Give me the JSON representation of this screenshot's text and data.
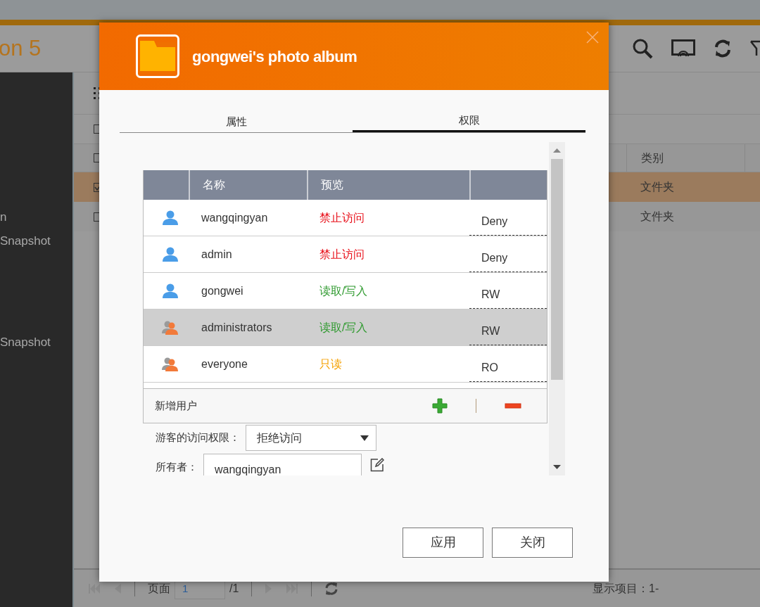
{
  "app": {
    "title": "on 5"
  },
  "sidebar": {
    "items": [
      {
        "label": "n"
      },
      {
        "label": "Snapshot"
      },
      {
        "label": "Snapshot"
      }
    ]
  },
  "files": {
    "toolbar_checkbox": {
      "checked": false
    },
    "header_checkbox": {
      "checked": false
    },
    "columns": [
      "类别"
    ],
    "rows": [
      {
        "type": "文件夹",
        "selected": true,
        "checked": true
      },
      {
        "type": "文件夹",
        "selected": false,
        "checked": false
      }
    ]
  },
  "pager": {
    "page_label": "页面",
    "page": "1",
    "total": "/1",
    "summary": "显示项目：1-"
  },
  "dialog": {
    "title": "gongwei's photo album",
    "tabs": [
      {
        "label": "属性",
        "selected": false
      },
      {
        "label": "权限",
        "selected": true
      }
    ],
    "columns": [
      "名称",
      "预览"
    ],
    "rows": [
      {
        "kind": "user",
        "name": "wangqingyan",
        "preview": "禁止访问",
        "color": "#e8101a",
        "value": "Deny",
        "selected": false
      },
      {
        "kind": "user",
        "name": "admin",
        "preview": "禁止访问",
        "color": "#e8101a",
        "value": "Deny",
        "selected": false
      },
      {
        "kind": "user",
        "name": "gongwei",
        "preview": "读取/写入",
        "color": "#2f9a2f",
        "value": "RW",
        "selected": false
      },
      {
        "kind": "group",
        "name": "administrators",
        "preview": "读取/写入",
        "color": "#2f9a2f",
        "value": "RW",
        "selected": true
      },
      {
        "kind": "group",
        "name": "everyone",
        "preview": "只读",
        "color": "#f5a000",
        "value": "RO",
        "selected": false
      }
    ],
    "add_user": "新增用户",
    "guest_label": "游客的访问权限：",
    "guest_value": "拒绝访问",
    "owner_label": "所有者：",
    "owner_value": "wangqingyan",
    "buttons": [
      "应用",
      "关闭"
    ]
  }
}
